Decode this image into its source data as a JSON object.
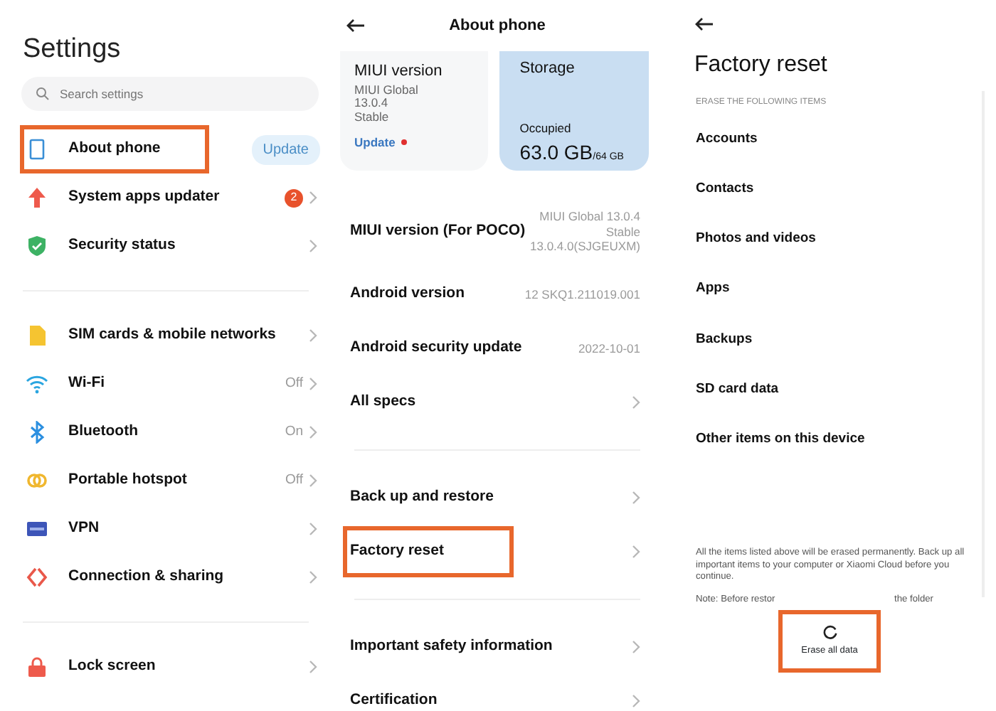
{
  "settings": {
    "title": "Settings",
    "search": {
      "placeholder": "Search settings"
    },
    "groups": [
      [
        {
          "kind": "phone",
          "label": "About phone",
          "pill": "Update",
          "highlighted": true
        },
        {
          "kind": "arrow-up",
          "label": "System apps updater",
          "badge": "2",
          "highlighted": false
        },
        {
          "kind": "shield",
          "label": "Security status",
          "highlighted": false
        }
      ],
      [
        {
          "kind": "sim",
          "label": "SIM cards & mobile networks",
          "highlighted": false
        },
        {
          "kind": "wifi",
          "label": "Wi-Fi",
          "value": "Off",
          "highlighted": false
        },
        {
          "kind": "bluetooth",
          "label": "Bluetooth",
          "value": "On",
          "highlighted": false
        },
        {
          "kind": "hotspot",
          "label": "Portable hotspot",
          "value": "Off",
          "highlighted": false
        },
        {
          "kind": "vpn",
          "label": "VPN",
          "highlighted": false
        },
        {
          "kind": "share",
          "label": "Connection & sharing",
          "highlighted": false
        }
      ],
      [
        {
          "kind": "lock",
          "label": "Lock screen",
          "highlighted": false
        }
      ]
    ]
  },
  "about": {
    "title": "About phone",
    "version_card": {
      "title": "MIUI version",
      "lines": [
        "MIUI Global",
        "13.0.4",
        "Stable"
      ],
      "link": "Update"
    },
    "storage_card": {
      "title": "Storage",
      "caption": "Occupied",
      "used": "63.0 GB",
      "total": "/64 GB"
    },
    "groups": [
      [
        {
          "label": "MIUI version (For POCO)",
          "value": "MIUI Global 13.0.4\nStable\n13.0.4.0(SJGEUXM)",
          "chevron": false,
          "highlighted": false
        },
        {
          "label": "Android version",
          "value": "12 SKQ1.211019.001",
          "chevron": false,
          "highlighted": false
        },
        {
          "label": "Android security update",
          "value": "2022-10-01",
          "chevron": false,
          "highlighted": false
        },
        {
          "label": "All specs",
          "chevron": true,
          "highlighted": false
        }
      ],
      [
        {
          "label": "Back up and restore",
          "chevron": true,
          "highlighted": false
        },
        {
          "label": "Factory reset",
          "chevron": true,
          "highlighted": true
        }
      ],
      [
        {
          "label": "Important safety information",
          "chevron": true,
          "highlighted": false
        },
        {
          "label": "Certification",
          "chevron": true,
          "highlighted": false
        }
      ]
    ]
  },
  "reset": {
    "title": "Factory reset",
    "caption": "ERASE THE FOLLOWING ITEMS",
    "items": [
      "Accounts",
      "Contacts",
      "Photos and videos",
      "Apps",
      "Backups",
      "SD card data",
      "Other items on this device"
    ],
    "warning": "All the items listed above will be erased permanently. Back up all important items to your computer or Xiaomi Cloud before you continue.",
    "note_parts": [
      "Note: Before restor",
      "the folder"
    ],
    "erase_button": {
      "label": "Erase all data",
      "highlighted": true
    }
  }
}
